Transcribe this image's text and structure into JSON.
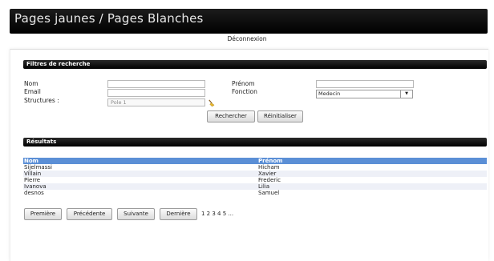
{
  "app": {
    "title": "Pages jaunes / Pages Blanches"
  },
  "header": {
    "logout_label": "Déconnexion"
  },
  "filters": {
    "section_title": "Filtres de recherche",
    "nom_label": "Nom",
    "email_label": "Email",
    "structures_label": "Structures :",
    "structures_value": "Pole 1",
    "prenom_label": "Prénom",
    "fonction_label": "Fonction",
    "fonction_value": "Medecin",
    "search_button": "Rechercher",
    "reset_button": "Réinitialiser"
  },
  "results": {
    "section_title": "Résultats",
    "columns": [
      "Nom",
      "Prénom"
    ],
    "rows": [
      [
        "Sijelmassi",
        "Hicham"
      ],
      [
        "Villain",
        "Xavier"
      ],
      [
        "Pierre",
        "Frederic"
      ],
      [
        "Ivanova",
        "Lilia"
      ],
      [
        "desnos",
        "Samuel"
      ]
    ]
  },
  "pagination": {
    "first": "Première",
    "previous": "Précédente",
    "next": "Suivante",
    "last": "Dernière",
    "pages": "1 2 3 4 5 ..."
  },
  "icons": {
    "broom": "broom-icon",
    "dropdown": "chevron-down-icon"
  }
}
